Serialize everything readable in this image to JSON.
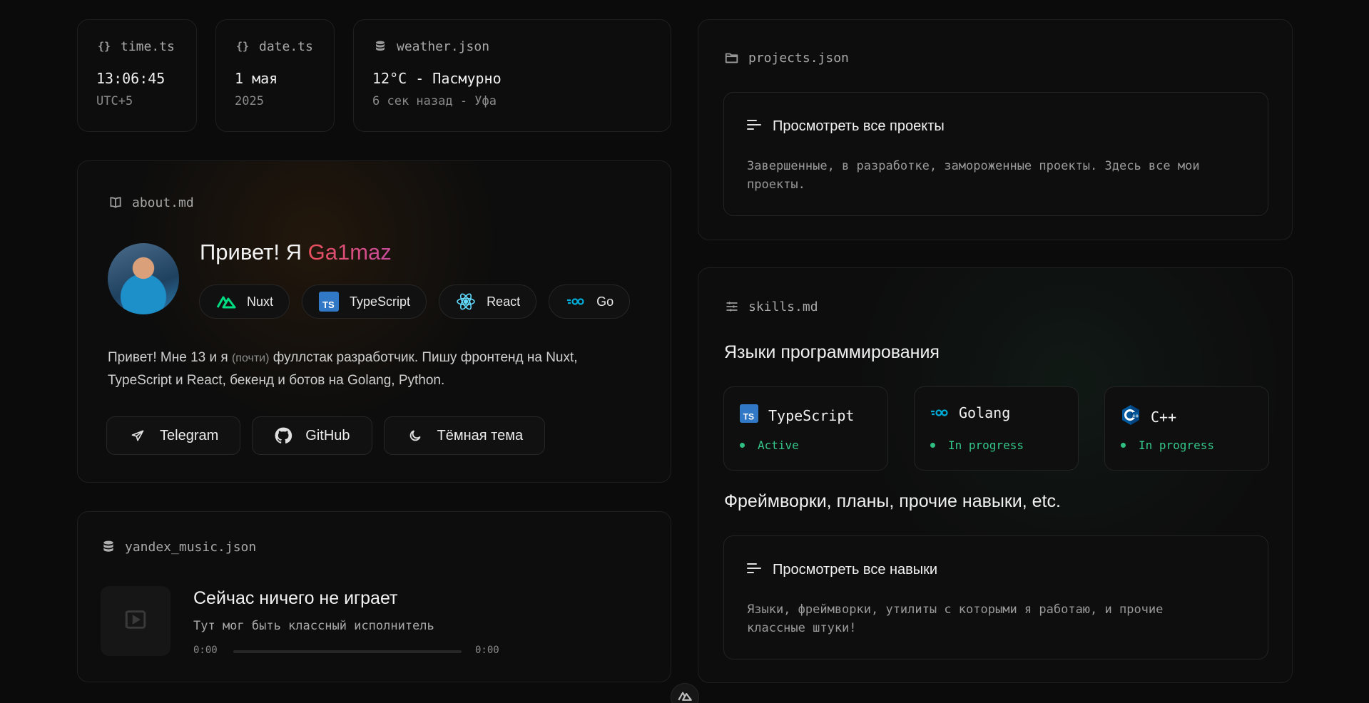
{
  "time_card": {
    "file": "time.ts",
    "value": "13:06:45",
    "sub": "UTC+5",
    "icon": "braces-icon"
  },
  "date_card": {
    "file": "date.ts",
    "value": "1 мая",
    "sub": "2025",
    "icon": "braces-icon"
  },
  "weather_card": {
    "file": "weather.json",
    "value": "12°C - Пасмурно",
    "sub": "6 сек назад - Уфа",
    "icon": "database-icon"
  },
  "about": {
    "file": "about.md",
    "greeting": "Привет! Я ",
    "nickname": "Ga1maz",
    "tech": [
      {
        "label": "Nuxt",
        "icon": "nuxt-icon",
        "color": "#00dc82"
      },
      {
        "label": "TypeScript",
        "icon": "typescript-icon",
        "color": "#3178c6"
      },
      {
        "label": "React",
        "icon": "react-icon",
        "color": "#61dafb"
      },
      {
        "label": "Go",
        "icon": "go-icon",
        "color": "#00add8"
      }
    ],
    "bio_start": "Привет! Мне 13 и я ",
    "bio_note": "(почти)",
    "bio_end": " фуллстак разработчик. Пишу фронтенд на Nuxt, TypeScript и React, бекенд и ботов на Golang, Python.",
    "links": [
      {
        "label": "Telegram",
        "icon": "telegram-icon"
      },
      {
        "label": "GitHub",
        "icon": "github-icon"
      },
      {
        "label": "Тёмная тема",
        "icon": "moon-icon"
      }
    ]
  },
  "music": {
    "file": "yandex_music.json",
    "title": "Сейчас ничего не играет",
    "artist": "Тут мог быть классный исполнитель",
    "time_start": "0:00",
    "time_end": "0:00",
    "progress": 0
  },
  "projects": {
    "file": "projects.json",
    "card_title": "Просмотреть все проекты",
    "card_desc": "Завершенные, в разработке, замороженные проекты. Здесь все мои проекты."
  },
  "skills": {
    "file": "skills.md",
    "languages_heading": "Языки программирования",
    "languages": [
      {
        "name": "TypeScript",
        "status": "Active",
        "icon": "typescript-icon"
      },
      {
        "name": "Golang",
        "status": "In progress",
        "icon": "go-icon"
      },
      {
        "name": "C++",
        "status": "In progress",
        "icon": "cpp-icon"
      }
    ],
    "frameworks_heading": "Фреймворки, планы, прочие навыки, etc.",
    "card_title": "Просмотреть все навыки",
    "card_desc": "Языки, фреймворки, утилиты с которыми я работаю, и прочие классные штуки!"
  },
  "colors": {
    "accent_green": "#2fbf82",
    "nick_red": "#e24d5e",
    "background": "#0b0b0b"
  }
}
